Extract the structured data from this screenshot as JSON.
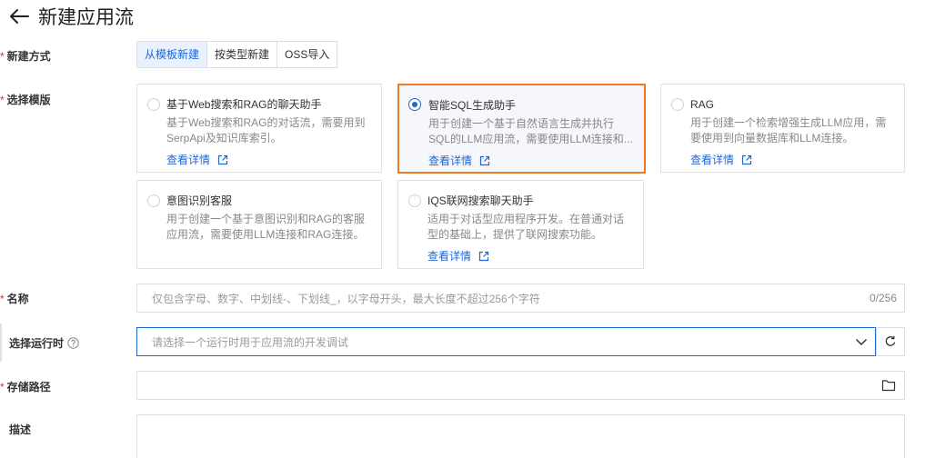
{
  "header": {
    "title": "新建应用流"
  },
  "form": {
    "create_method": {
      "label": "新建方式",
      "options": [
        "从模板新建",
        "按类型新建",
        "OSS导入"
      ],
      "selected": "从模板新建"
    },
    "template": {
      "label": "选择模版",
      "cards": [
        {
          "title": "基于Web搜索和RAG的聊天助手",
          "desc": "基于Web搜索和RAG的对话流，需要用到SerpApi及知识库索引。",
          "link": "查看详情",
          "selected": false
        },
        {
          "title": "智能SQL生成助手",
          "desc": "用于创建一个基于自然语言生成并执行SQL的LLM应用流，需要使用LLM连接和...",
          "link": "查看详情",
          "selected": true
        },
        {
          "title": "RAG",
          "desc": "用于创建一个检索增强生成LLM应用，需要使用到向量数据库和LLM连接。",
          "link": "查看详情",
          "selected": false
        },
        {
          "title": "意图识别客服",
          "desc": "用于创建一个基于意图识别和RAG的客服应用流，需要使用LLM连接和RAG连接。",
          "link": "",
          "selected": false
        },
        {
          "title": "IQS联网搜索聊天助手",
          "desc": "适用于对话型应用程序开发。在普通对话型的基础上，提供了联网搜索功能。",
          "link": "查看详情",
          "selected": false
        }
      ]
    },
    "name": {
      "label": "名称",
      "placeholder": "仅包含字母、数字、中划线-、下划线_，以字母开头，最大长度不超过256个字符",
      "counter": "0/256"
    },
    "runtime": {
      "label": "选择运行时",
      "placeholder": "请选择一个运行时用于应用流的开发调试"
    },
    "storage": {
      "label": "存储路径"
    },
    "description": {
      "label": "描述"
    }
  },
  "colors": {
    "accent": "#1f67d1",
    "selected_border": "#ee7a24",
    "required": "#d93026"
  }
}
